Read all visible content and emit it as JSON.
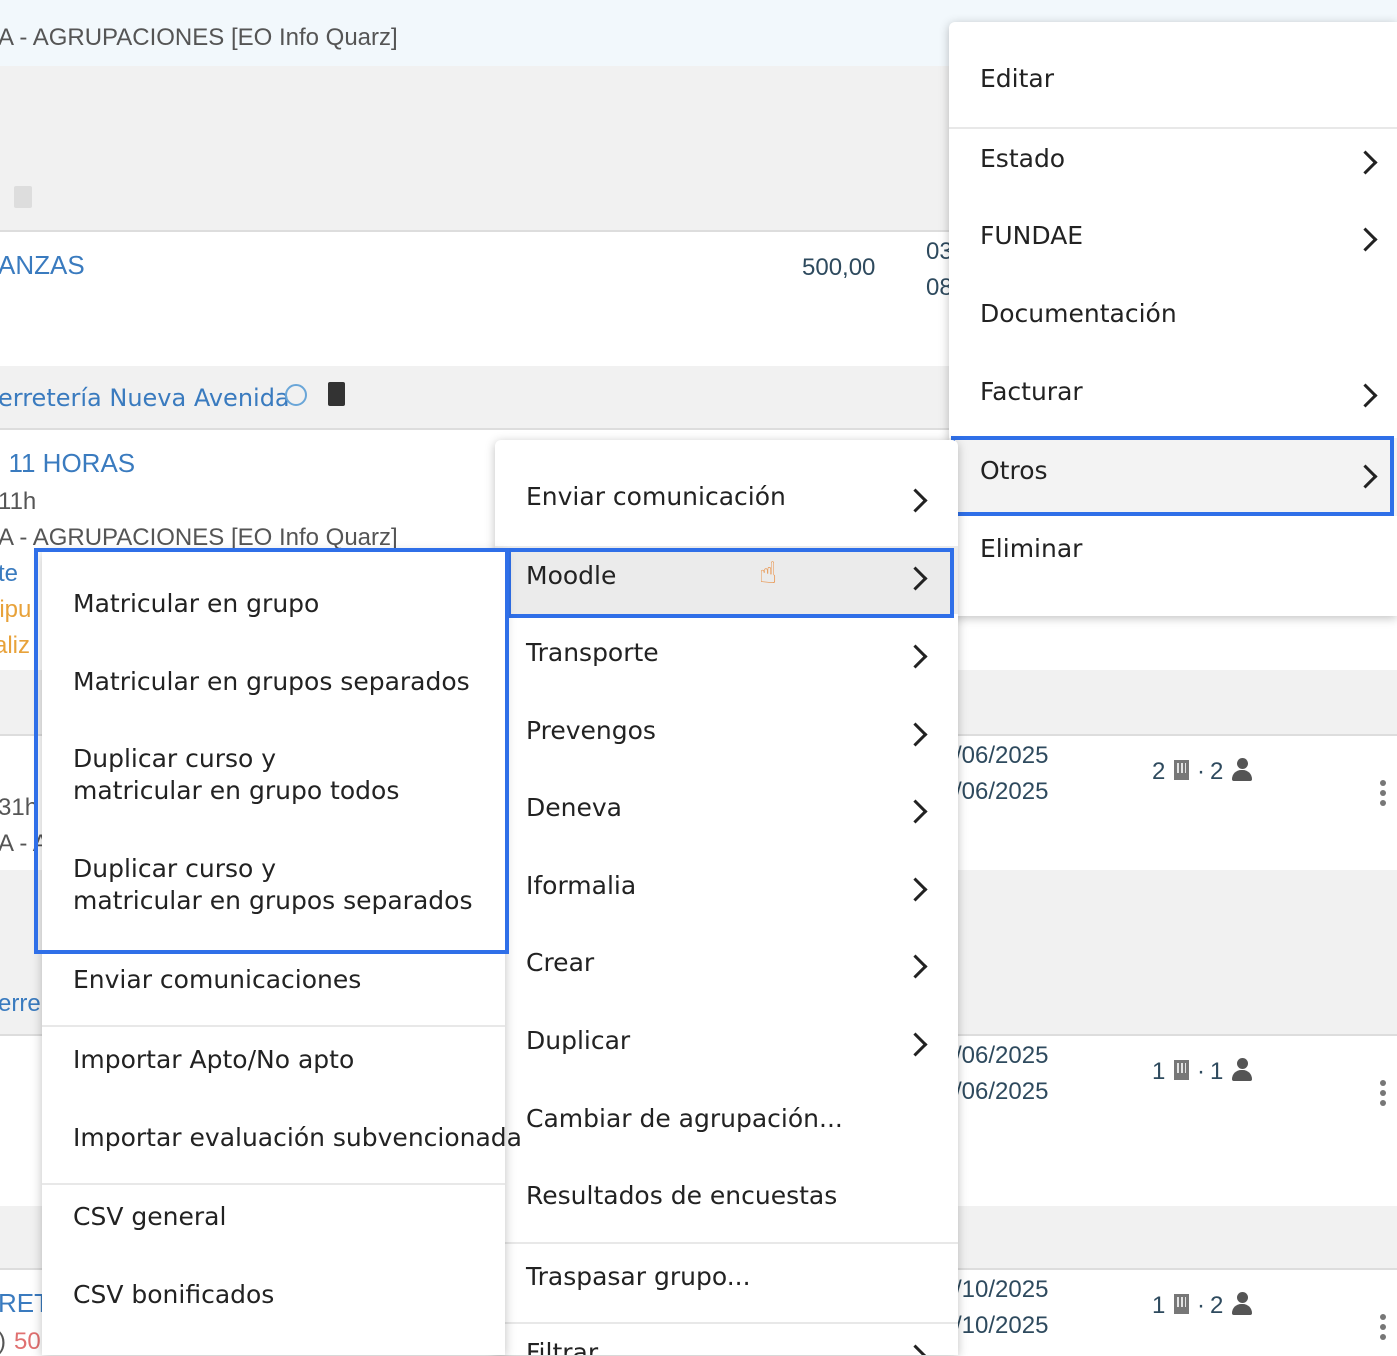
{
  "background": {
    "header_title": "A - AGRUPACIONES [EO Info Quarz]",
    "row1": {
      "name": "ANZAS",
      "amount": "500,00",
      "date1": "03",
      "date2": "08"
    },
    "row2_company": "erretería Nueva Avenida",
    "row3": {
      "name": ". 11 HORAS",
      "hours": "11h",
      "group": "A - AGRUPACIONES [EO Info Quarz]",
      "status1": "te",
      "status2": "iipu",
      "status3": "aliz"
    },
    "row4": {
      "hours": "31h",
      "group": "A - A",
      "date1": "/06/2025",
      "date2": "/06/2025",
      "count_a": "2",
      "count_b": "2"
    },
    "row5": {
      "company": "erre",
      "date1": "/06/2025",
      "date2": "/06/2025",
      "count_a": "1",
      "count_b": "1"
    },
    "row6": {
      "name": "RET",
      "prefix": ")",
      "value": "50",
      "date1": "/10/2025",
      "date2": "/10/2025",
      "count_a": "1",
      "count_b": "2"
    }
  },
  "main_menu": {
    "items": [
      {
        "label": "Editar",
        "submenu": false
      },
      {
        "label": "Estado",
        "submenu": true
      },
      {
        "label": "FUNDAE",
        "submenu": true
      },
      {
        "label": "Documentación",
        "submenu": false
      },
      {
        "label": "Facturar",
        "submenu": true
      },
      {
        "label": "Otros",
        "submenu": true,
        "highlighted": true
      },
      {
        "label": "Eliminar",
        "submenu": false
      }
    ]
  },
  "otros_menu": {
    "items": [
      {
        "label": "Enviar comunicación",
        "submenu": true
      },
      {
        "label": "Moodle",
        "submenu": true,
        "highlighted": true
      },
      {
        "label": "Transporte",
        "submenu": true
      },
      {
        "label": "Prevengos",
        "submenu": true
      },
      {
        "label": "Deneva",
        "submenu": true
      },
      {
        "label": "Iformalia",
        "submenu": true
      },
      {
        "label": "Crear",
        "submenu": true
      },
      {
        "label": "Duplicar",
        "submenu": true
      },
      {
        "label": "Cambiar de agrupación...",
        "submenu": false
      },
      {
        "label": "Resultados de encuestas",
        "submenu": false
      },
      {
        "label": "Traspasar grupo...",
        "submenu": false
      },
      {
        "label": "Filtrar",
        "submenu": true
      }
    ]
  },
  "moodle_menu": {
    "items": [
      {
        "label": "Matricular en grupo"
      },
      {
        "label": "Matricular en grupos separados"
      },
      {
        "label_line1": "Duplicar curso y",
        "label_line2": "matricular en grupo todos"
      },
      {
        "label_line1": "Duplicar curso y",
        "label_line2": "matricular en grupos separados"
      },
      {
        "label": "Enviar comunicaciones"
      },
      {
        "label": "Importar Apto/No apto"
      },
      {
        "label": "Importar evaluación subvencionada"
      },
      {
        "label": "CSV general"
      },
      {
        "label": "CSV bonificados"
      }
    ]
  },
  "colors": {
    "highlight": "#2f6fe8",
    "link": "#3a7bbf",
    "warning": "#e8a23a"
  }
}
